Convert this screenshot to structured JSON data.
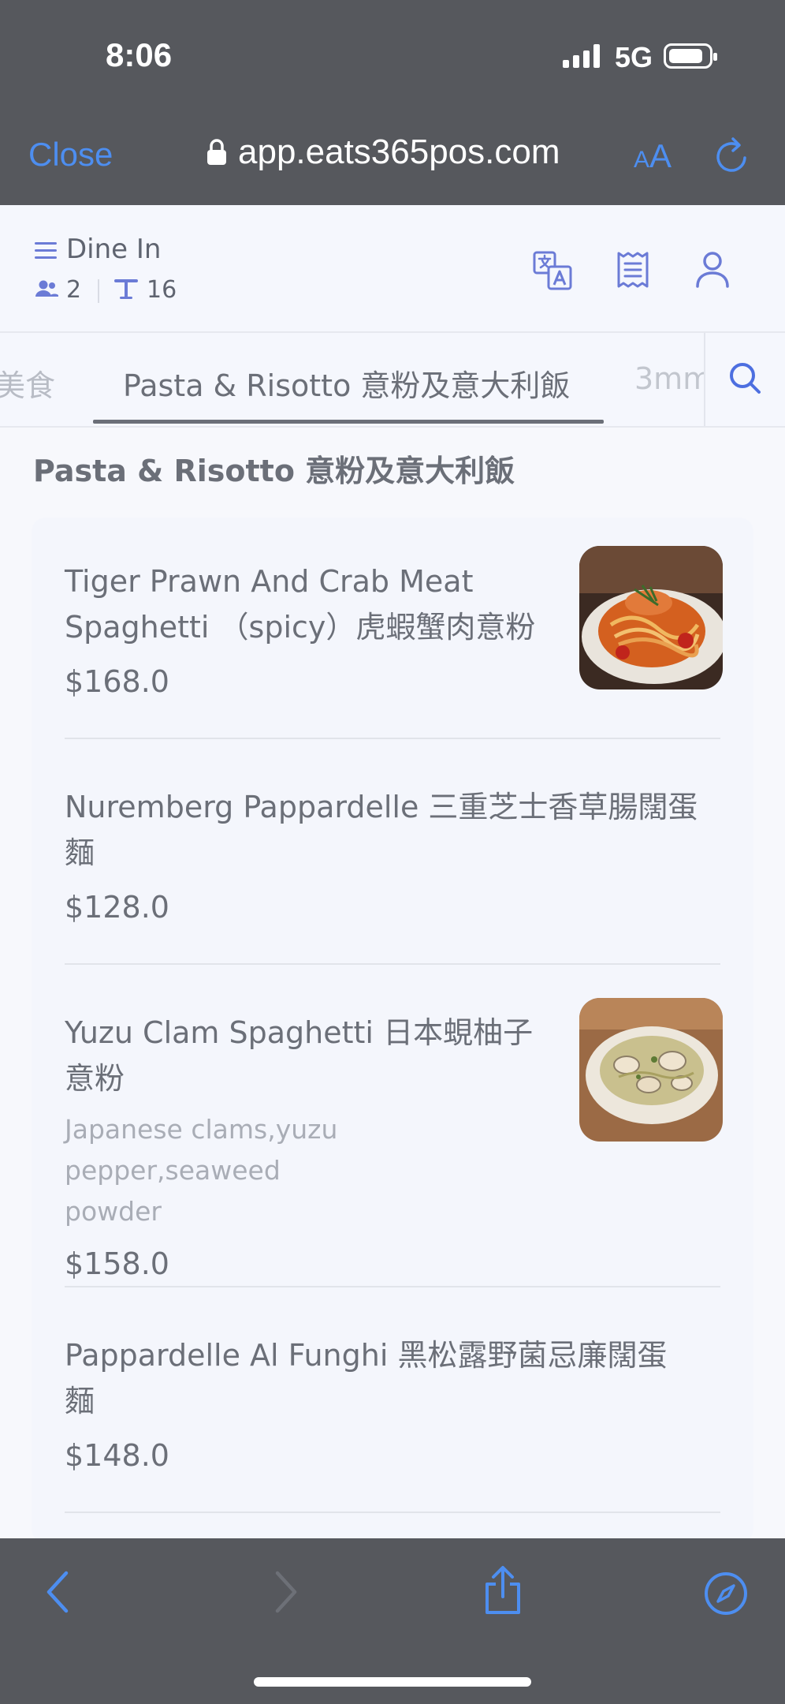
{
  "status_bar": {
    "time": "8:06",
    "network": "5G"
  },
  "browser": {
    "close_label": "Close",
    "url": "app.eats365pos.com",
    "aa_small": "A",
    "aa_big": "A"
  },
  "header": {
    "order_type": "Dine In",
    "guests": "2",
    "table": "16"
  },
  "tabs": {
    "prev": "美食",
    "active": "Pasta & Risotto 意粉及意大利飯",
    "next": "3mm"
  },
  "section": {
    "title": "Pasta & Risotto 意粉及意大利飯"
  },
  "items": [
    {
      "name_line1": "Tiger Prawn And Crab Meat",
      "name_line2": "Spaghetti （spicy）虎蝦蟹肉意粉",
      "price": "$168.0"
    },
    {
      "name_line1": "Nuremberg Pappardelle 三重芝士香草腸闊蛋",
      "name_line2": "麵",
      "price": "$128.0"
    },
    {
      "name_line1": "Yuzu Clam Spaghetti 日本蜆柚子",
      "name_line2": "意粉",
      "desc_line1": "Japanese clams,yuzu pepper,seaweed",
      "desc_line2": "powder",
      "price": "$158.0"
    },
    {
      "name_line1": "Pappardelle Al Funghi 黑松露野菌忌廉闊蛋",
      "name_line2": "麵",
      "price": "$148.0"
    }
  ],
  "colors": {
    "accent": "#4d8ef0",
    "chrome": "#56585d",
    "text": "#6b6f78"
  }
}
